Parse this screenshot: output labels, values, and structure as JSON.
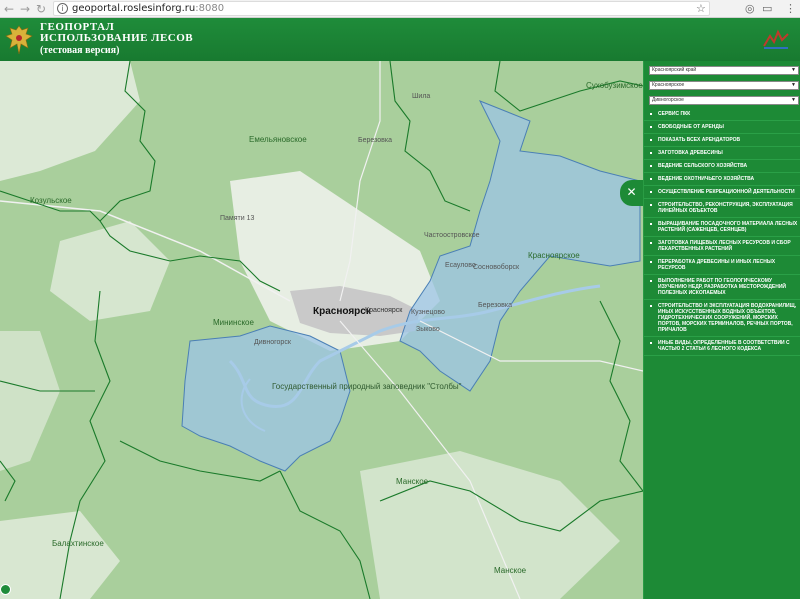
{
  "browser": {
    "back_icon": "arrow-left-icon",
    "forward_icon": "arrow-right-icon",
    "reload_icon": "reload-icon",
    "url_host": "geoportal.roslesinforg.ru",
    "url_port": ":8080",
    "star_icon": "star-icon",
    "menu_icon": "more-vert-icon"
  },
  "header": {
    "title_line1": "ГЕОПОРТАЛ",
    "title_line2": "ИСПОЛЬЗОВАНИЕ ЛЕСОВ",
    "title_line3": "(тестовая версия)",
    "emblem_icon": "double-eagle-emblem-icon",
    "right_logo_icon": "roslesinforg-logo-icon"
  },
  "map": {
    "labels": {
      "sukhobuz": "Сухобузимское",
      "emelyan": "Емельяновское",
      "kozulka": "Козульское",
      "krasnoyarsk": "Красноярск",
      "krasnoyarsk2": "Красноярск",
      "minino": "Мининское",
      "krasnoyarskoe": "Красноярское",
      "stolby": "Государственный природный заповедник \"Столбы\"",
      "manskoe": "Манское",
      "balakhta": "Балахтинское",
      "manskoe2": "Манское",
      "divnogorsk": "Дивногорск",
      "shila": "Шила",
      "pimi": "Памяти 13",
      "berezovka": "Березовка",
      "chastoostrovskoe": "Частоостровское",
      "esaulovo": "Есаулово",
      "sosnovoborsk": "Сосновоборск",
      "beryozovka": "Березовка",
      "zykovo": "Зыково",
      "kuznetsovo": "Кузнецово"
    },
    "colors": {
      "forest": "#a9cf9c",
      "light_land": "#e6efe2",
      "lease_fill": "#9cc4e6",
      "boundary": "#1a7a2a",
      "water": "#a7cbe8"
    }
  },
  "panel": {
    "select_region": "Красноярский край",
    "select_forestry": "Красноярское",
    "select_district": "Дивногорское",
    "collapse_icon": "close-icon",
    "menu_items": [
      "СЕРВИС ПКК",
      "СВОБОДНЫЕ ОТ АРЕНДЫ",
      "ПОКАЗАТЬ ВСЕХ АРЕНДАТОРОВ",
      "ЗАГОТОВКА ДРЕВЕСИНЫ",
      "ВЕДЕНИЕ СЕЛЬСКОГО ХОЗЯЙСТВА",
      "ВЕДЕНИЕ ОХОТНИЧЬЕГО ХОЗЯЙСТВА",
      "ОСУЩЕСТВЛЕНИЕ РЕКРЕАЦИОННОЙ ДЕЯТЕЛЬНОСТИ",
      "СТРОИТЕЛЬСТВО, РЕКОНСТРУКЦИЯ, ЭКСПЛУАТАЦИЯ ЛИНЕЙНЫХ ОБЪЕКТОВ",
      "ВЫРАЩИВАНИЕ ПОСАДОЧНОГО МАТЕРИАЛА ЛЕСНЫХ РАСТЕНИЙ (САЖЕНЦЕВ, СЕЯНЦЕВ)",
      "ЗАГОТОВКА ПИЩЕВЫХ ЛЕСНЫХ РЕСУРСОВ И СБОР ЛЕКАРСТВЕННЫХ РАСТЕНИЙ",
      "ПЕРЕРАБОТКА ДРЕВЕСИНЫ И ИНЫХ ЛЕСНЫХ РЕСУРСОВ",
      "ВЫПОЛНЕНИЕ РАБОТ ПО ГЕОЛОГИЧЕСКОМУ ИЗУЧЕНИЮ НЕДР, РАЗРАБОТКА МЕСТОРОЖДЕНИЙ ПОЛЕЗНЫХ ИСКОПАЕМЫХ",
      "СТРОИТЕЛЬСТВО И ЭКСПЛУАТАЦИЯ ВОДОХРАНИЛИЩ, ИНЫХ ИСКУССТВЕННЫХ ВОДНЫХ ОБЪЕКТОВ, ГИДРОТЕХНИЧЕСКИХ СООРУЖЕНИЙ, МОРСКИХ ПОРТОВ, МОРСКИХ ТЕРМИНАЛОВ, РЕЧНЫХ ПОРТОВ, ПРИЧАЛОВ",
      "ИНЫЕ ВИДЫ, ОПРЕДЕЛЕННЫЕ В СООТВЕТСТВИИ С ЧАСТЬЮ 2 СТАТЬИ 6 ЛЕСНОГО КОДЕКСА"
    ]
  }
}
